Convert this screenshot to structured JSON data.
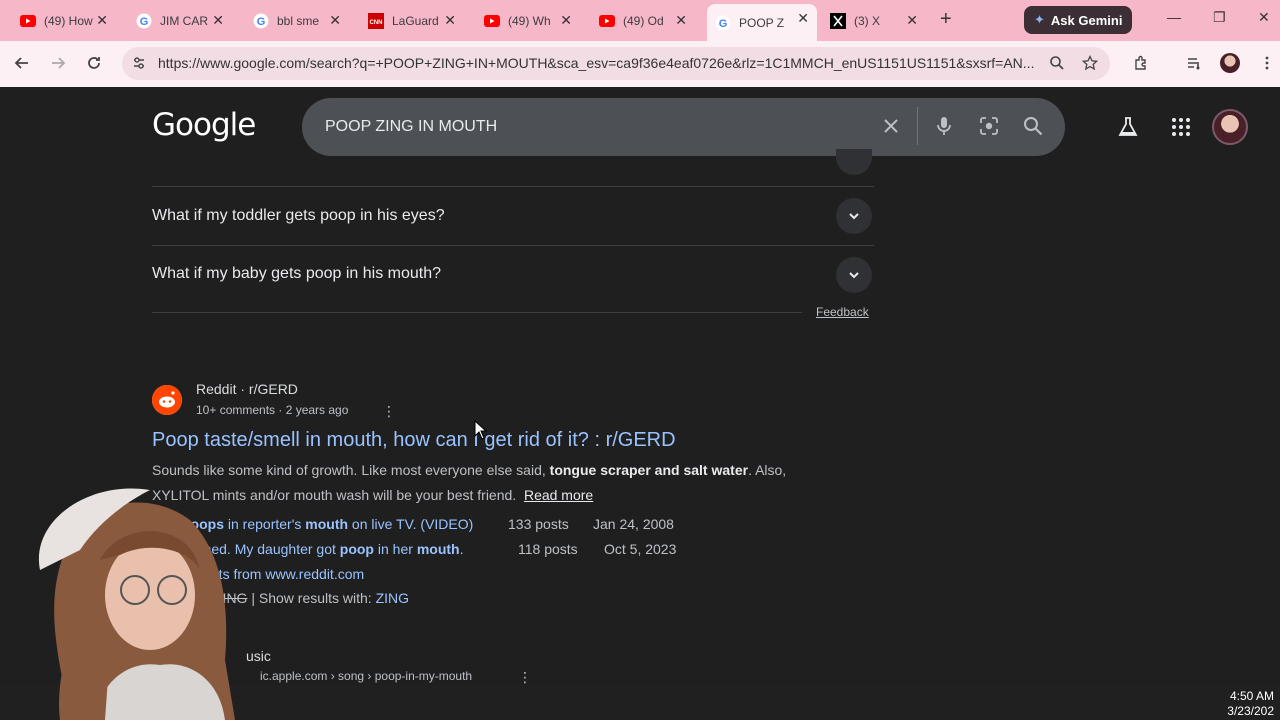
{
  "browser": {
    "tabs": [
      {
        "label": "(49) How",
        "icon": "youtube-icon",
        "color": "#ff0000"
      },
      {
        "label": "JIM CAR",
        "icon": "google-icon",
        "color": "#4285f4"
      },
      {
        "label": "bbl sme",
        "icon": "google-icon",
        "color": "#4285f4"
      },
      {
        "label": "LaGuard",
        "icon": "cnn-icon",
        "color": "#cc0000"
      },
      {
        "label": "(49) Wh",
        "icon": "youtube-icon",
        "color": "#ff0000"
      },
      {
        "label": "(49) Od",
        "icon": "youtube-icon",
        "color": "#ff0000"
      },
      {
        "label": "POOP Z",
        "icon": "google-icon",
        "color": "#4285f4",
        "active": true
      },
      {
        "label": "(3) X",
        "icon": "x-icon",
        "color": "#000000"
      }
    ],
    "gemini_label": "Ask Gemini",
    "url": "https://www.google.com/search?q=+POOP+ZING+IN+MOUTH&sca_esv=ca9f36e4eaf0726e&rlz=1C1MMCH_enUS1151US1151&sxsrf=AN..."
  },
  "search": {
    "logo": "Google",
    "query": "POOP ZING IN MOUTH"
  },
  "faq": {
    "items": [
      "What if my toddler gets poop in his eyes?",
      "What if my baby gets poop in his mouth?"
    ],
    "feedback_label": "Feedback"
  },
  "result": {
    "site_name": "Reddit · r/GERD",
    "meta": "10+ comments · 2 years ago",
    "title": "Poop taste/smell in mouth, how can I get rid of it? : r/GERD",
    "snippet_part1": "Sounds like some kind of growth. Like most everyone else said, ",
    "snippet_bold": "tongue scraper and salt water",
    "snippet_part2": ". Also,",
    "snippet_line2": "XYLITOL mints and/or mouth wash will be your best friend.",
    "read_more": "Read more",
    "sublinks": [
      {
        "pre": "",
        "bold1": "poops",
        "mid": " in reporter's ",
        "bold2": "mouth",
        "post": " on live TV. (VIDEO)",
        "posts": "133 posts",
        "date": "Jan 24, 2008"
      },
      {
        "pre": "pened. My daughter got ",
        "bold1": "poop",
        "mid": " in her ",
        "bold2": "mouth",
        "post": ".",
        "posts": "118 posts",
        "date": "Oct 5, 2023"
      }
    ],
    "more_results": "esults from www.reddit.com",
    "missing_word": "ZING",
    "show_with_label": " | Show results with: ",
    "show_with_word": "ZING"
  },
  "next_result": {
    "site_name": "usic",
    "url": "ic.apple.com › song › poop-in-my-mouth"
  },
  "taskbar": {
    "time": "4:50 AM",
    "date": "3/23/202"
  }
}
